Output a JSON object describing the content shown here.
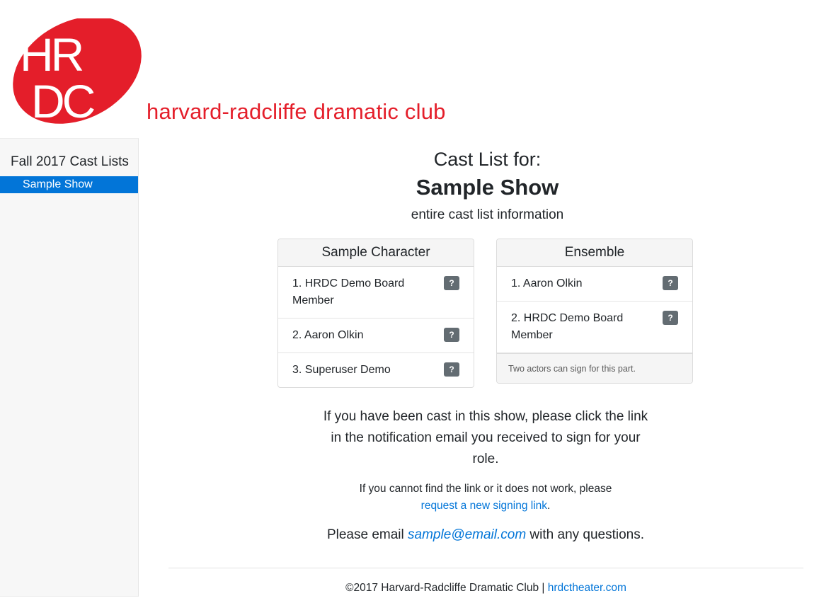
{
  "header": {
    "logo_letters_top": "HR",
    "logo_letters_bottom": "DC",
    "club_name": "harvard-radcliffe dramatic club",
    "brand_color": "#e41e2a"
  },
  "sidebar": {
    "heading": "Fall 2017 Cast Lists",
    "items": [
      {
        "label": "Sample Show",
        "active": true
      }
    ]
  },
  "main": {
    "cast_list_for": "Cast List for:",
    "show_title": "Sample Show",
    "subtitle": "entire cast list information",
    "cards": [
      {
        "title": "Sample Character",
        "rows": [
          {
            "text": "1. HRDC Demo Board Member",
            "badge": "?"
          },
          {
            "text": "2. Aaron Olkin",
            "badge": "?"
          },
          {
            "text": "3. Superuser Demo",
            "badge": "?"
          }
        ],
        "footer": ""
      },
      {
        "title": "Ensemble",
        "rows": [
          {
            "text": "1. Aaron Olkin",
            "badge": "?"
          },
          {
            "text": "2. HRDC Demo Board Member",
            "badge": "?"
          }
        ],
        "footer": "Two actors can sign for this part."
      }
    ],
    "notice": "If you have been cast in this show, please click the link in the notification email you received to sign for your role.",
    "small_notice_text": "If you cannot find the link or it does not work, please",
    "signing_link_label": "request a new signing link",
    "small_notice_end": ".",
    "email_prefix": "Please email ",
    "email": "sample@email.com",
    "email_suffix": " with any questions."
  },
  "footer": {
    "copyright": "©2017 Harvard-Radcliffe Dramatic Club | ",
    "site_link": "hrdctheater.com"
  },
  "colors": {
    "accent": "#0275d8",
    "badge": "#636c72",
    "sidebar_bg": "#f7f7f7"
  }
}
